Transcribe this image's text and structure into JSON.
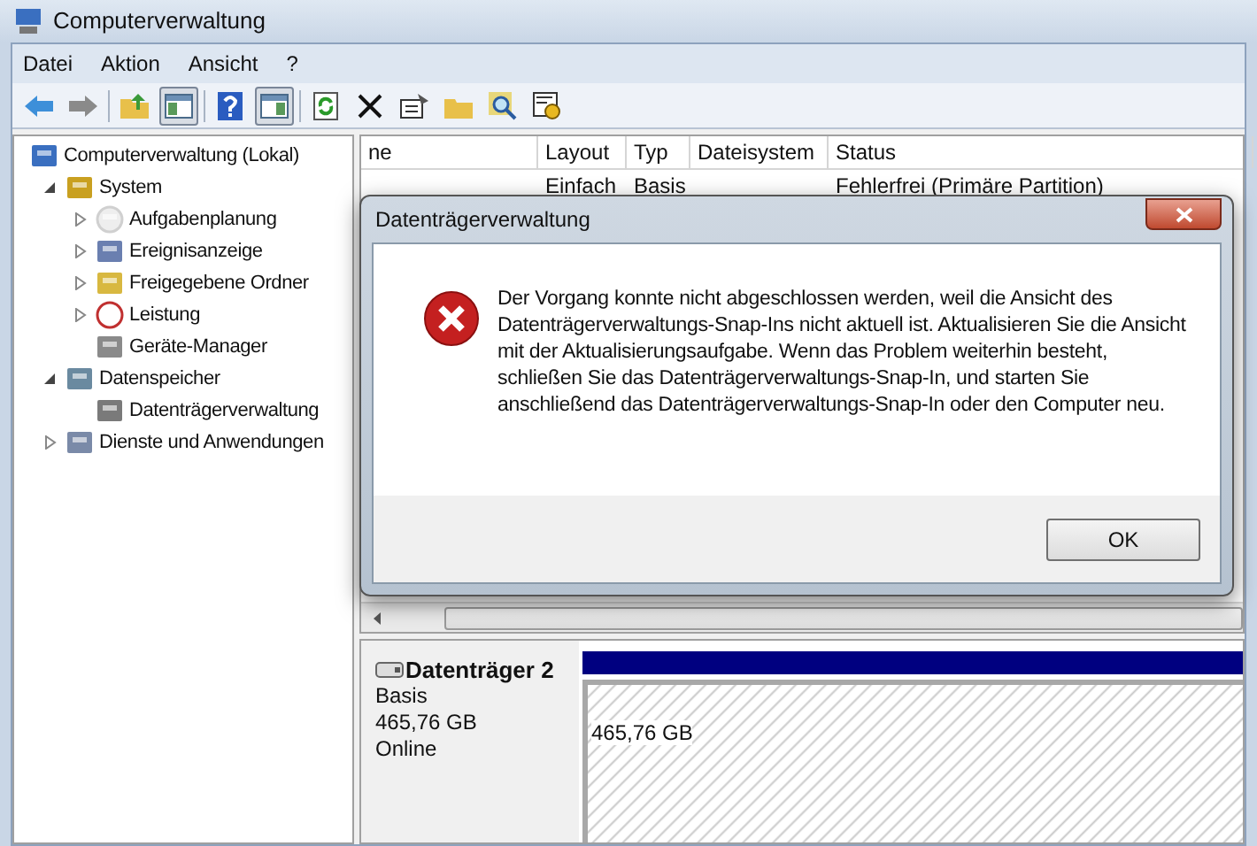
{
  "window": {
    "title": "Computerverwaltung"
  },
  "menu": [
    "Datei",
    "Aktion",
    "Ansicht",
    "?"
  ],
  "toolbar": [
    {
      "pressed": false
    },
    {
      "pressed": false
    },
    {
      "pressed": false
    },
    {
      "pressed": true
    },
    {
      "pressed": false
    },
    {
      "pressed": true
    },
    {
      "pressed": false
    },
    {
      "pressed": false
    },
    {
      "pressed": false
    },
    {
      "pressed": false
    },
    {
      "pressed": false
    },
    {
      "pressed": false
    }
  ],
  "tree": [
    {
      "label": "Computerverwaltung (Lokal)",
      "children": [
        {
          "label": "System",
          "expanded": true,
          "children": [
            {
              "label": "Aufgabenplanung",
              "expanded": false
            },
            {
              "label": "Ereignisanzeige",
              "expanded": false
            },
            {
              "label": "Freigegebene Ordner",
              "expanded": false
            },
            {
              "label": "Leistung",
              "expanded": false
            },
            {
              "label": "Geräte-Manager"
            }
          ]
        },
        {
          "label": "Datenspeicher",
          "expanded": true,
          "children": [
            {
              "label": "Datenträgerverwaltung"
            }
          ]
        },
        {
          "label": "Dienste und Anwendungen",
          "expanded": false
        }
      ]
    }
  ],
  "table": {
    "columns": [
      "ne",
      "Layout",
      "Typ",
      "Dateisystem",
      "Status"
    ],
    "rows": [
      [
        "",
        "Einfach",
        "Basis",
        "",
        "Fehlerfrei (Primäre Partition)"
      ]
    ]
  },
  "disk": {
    "name": "Datenträger 2",
    "type": "Basis",
    "size": "465,76 GB",
    "state": "Online",
    "partition_size": "465,76 GB"
  },
  "dialog": {
    "title": "Datenträgerverwaltung",
    "message": "Der Vorgang konnte nicht abgeschlossen werden, weil die Ansicht des Datenträgerverwaltungs-Snap-Ins nicht aktuell ist. Aktualisieren Sie die Ansicht mit der Aktualisierungsaufgabe. Wenn das Problem weiterhin besteht, schließen Sie das Datenträgerverwaltungs-Snap-In, und starten Sie anschließend das Datenträgerverwaltungs-Snap-In oder den Computer neu.",
    "buttons": [
      "OK"
    ]
  }
}
